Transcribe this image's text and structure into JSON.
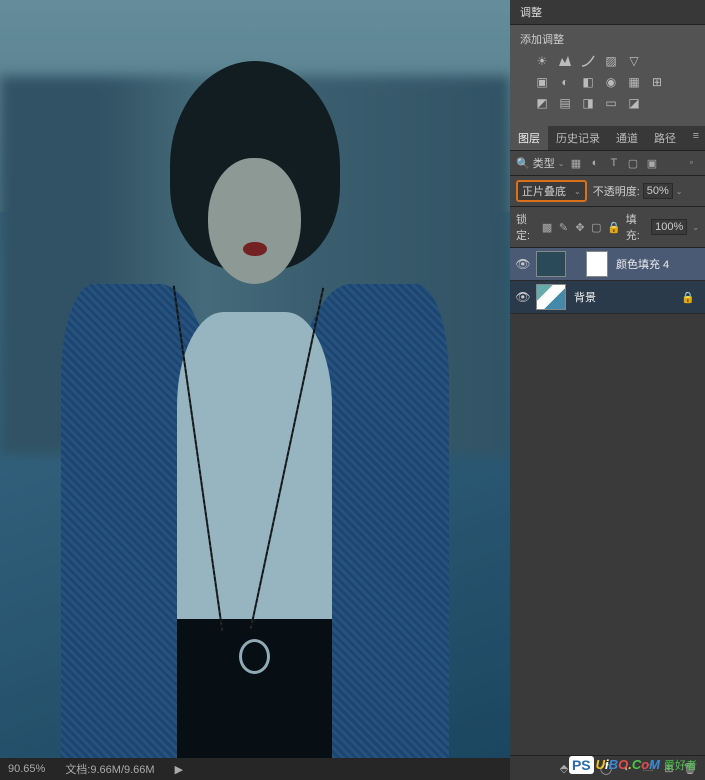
{
  "status": {
    "zoom": "90.65%",
    "doc_info": "文档:9.66M/9.66M"
  },
  "adjustments_panel": {
    "title": "调整",
    "add_label": "添加调整"
  },
  "layers_panel": {
    "tabs": [
      "图层",
      "历史记录",
      "通道",
      "路径"
    ],
    "filter_label": "类型",
    "blend_mode": "正片叠底",
    "opacity_label": "不透明度:",
    "opacity_value": "50%",
    "lock_label": "锁定:",
    "fill_label": "填充:",
    "fill_value": "100%",
    "layers": [
      {
        "name": "颜色填充 4"
      },
      {
        "name": "背景"
      }
    ]
  },
  "watermark": {
    "ps": "PS",
    "text": "UiBO.CoM",
    "chinese": "爱好者"
  }
}
